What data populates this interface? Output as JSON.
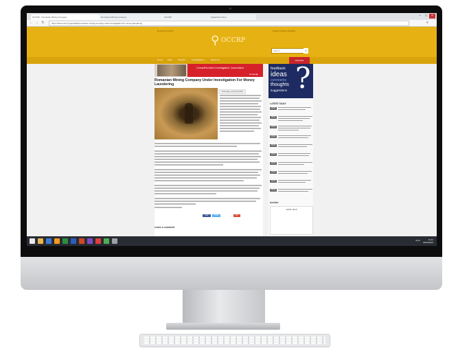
{
  "browser": {
    "tabs": [
      {
        "label": "OCCRP - Romanian Mining Company"
      },
      {
        "label": "Romanian Mining Company"
      },
      {
        "label": "OCCRP"
      },
      {
        "label": "Organized Crime"
      }
    ],
    "url": "https://www.occrp.org/en/daily/romanian-mining-company-under-investigation-for-money-laundering"
  },
  "site": {
    "header_top_left": "Reporting Project",
    "header_top_right": "English  Russian  Español",
    "logo_glyph": "⚲",
    "logo_word": "OCCRP",
    "search_placeholder": "Search",
    "search_icon": "search-icon",
    "nav": [
      "Home",
      "Daily",
      "Projects",
      "Investigations",
      "About Us"
    ],
    "nav_cta": "DONATE",
    "brand_color": "#e6b112"
  },
  "banner": {
    "text": "CrowdFunded Investigative Journalism",
    "cta": "Donate ▶"
  },
  "article": {
    "title": "Romanian Mining Company Under Investigation For Money Laundering",
    "date": "Thursday, 23 April 2015",
    "share": [
      "Like",
      "Tweet",
      "G+"
    ],
    "leave_comment": "Leave a comment"
  },
  "sidebar": {
    "ad": {
      "feedback": "feedback",
      "ideas": "ideas",
      "comments": "comments",
      "thoughts": "thoughts",
      "suggestions": "suggestions",
      "qmark": "?"
    },
    "latest_heading": "LATEST DAILY",
    "latest_dates": [
      "26.04",
      "25.04",
      "25.04",
      "24.04",
      "24.04",
      "23.04",
      "23.04",
      "23.04",
      "23.04",
      "22.04"
    ],
    "archive_heading": "Archive",
    "calendar_title": "APRIL 2015"
  },
  "taskbar": {
    "tray": "ENG",
    "time": "11:42",
    "date": "26/04/2015"
  }
}
